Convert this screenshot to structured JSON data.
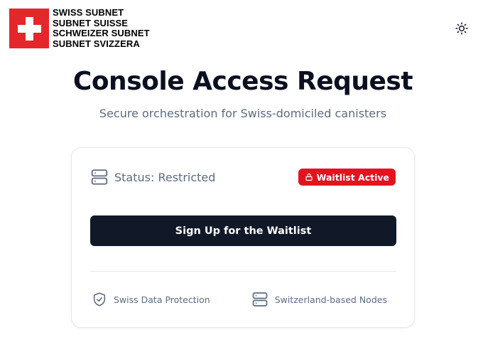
{
  "logo": {
    "lines": [
      "SWISS SUBNET",
      "SUBNET SUISSE",
      "SCHWEIZER SUBNET",
      "SUBNET SVIZZERA"
    ],
    "flag_color": "#e5262b"
  },
  "theme_toggle": {
    "icon": "sun-icon"
  },
  "header": {
    "title": "Console Access Request",
    "subtitle": "Secure orchestration for Swiss-domiciled canisters"
  },
  "card": {
    "status_label": "Status: Restricted",
    "status_icon": "server-icon",
    "badge": {
      "label": "Waitlist Active",
      "icon": "lock-icon",
      "color": "#e5121f"
    },
    "cta_label": "Sign Up for the Waitlist",
    "features": [
      {
        "icon": "shield-check-icon",
        "label": "Swiss Data Protection"
      },
      {
        "icon": "server-icon",
        "label": "Switzerland-based Nodes"
      }
    ]
  }
}
